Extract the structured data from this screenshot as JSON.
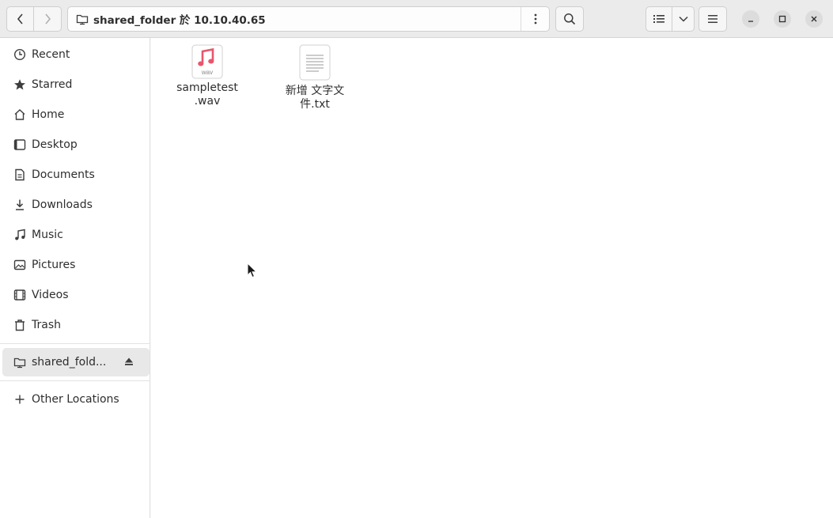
{
  "window": {
    "path_label": "shared_folder 於 10.10.40.65"
  },
  "sidebar": {
    "items": [
      {
        "label": "Recent",
        "icon": "clock-icon"
      },
      {
        "label": "Starred",
        "icon": "star-icon"
      },
      {
        "label": "Home",
        "icon": "home-icon"
      },
      {
        "label": "Desktop",
        "icon": "desktop-icon"
      },
      {
        "label": "Documents",
        "icon": "document-icon"
      },
      {
        "label": "Downloads",
        "icon": "download-icon"
      },
      {
        "label": "Music",
        "icon": "music-icon"
      },
      {
        "label": "Pictures",
        "icon": "picture-icon"
      },
      {
        "label": "Videos",
        "icon": "video-icon"
      },
      {
        "label": "Trash",
        "icon": "trash-icon"
      }
    ],
    "mount": {
      "label": "shared_fold...",
      "icon": "network-folder-icon"
    },
    "other": {
      "label": "Other Locations",
      "icon": "plus-icon"
    }
  },
  "files": [
    {
      "name_line1": "sampletest",
      "name_line2": ".wav",
      "thumb_label": "wav",
      "icon": "audio-file-icon"
    },
    {
      "name_line1": "新增 文字文",
      "name_line2": "件.txt",
      "icon": "text-file-icon"
    }
  ],
  "colors": {
    "accent_music": "#e9566b",
    "header_bg": "#ebebeb",
    "sidebar_active": "#e8e8e8"
  }
}
